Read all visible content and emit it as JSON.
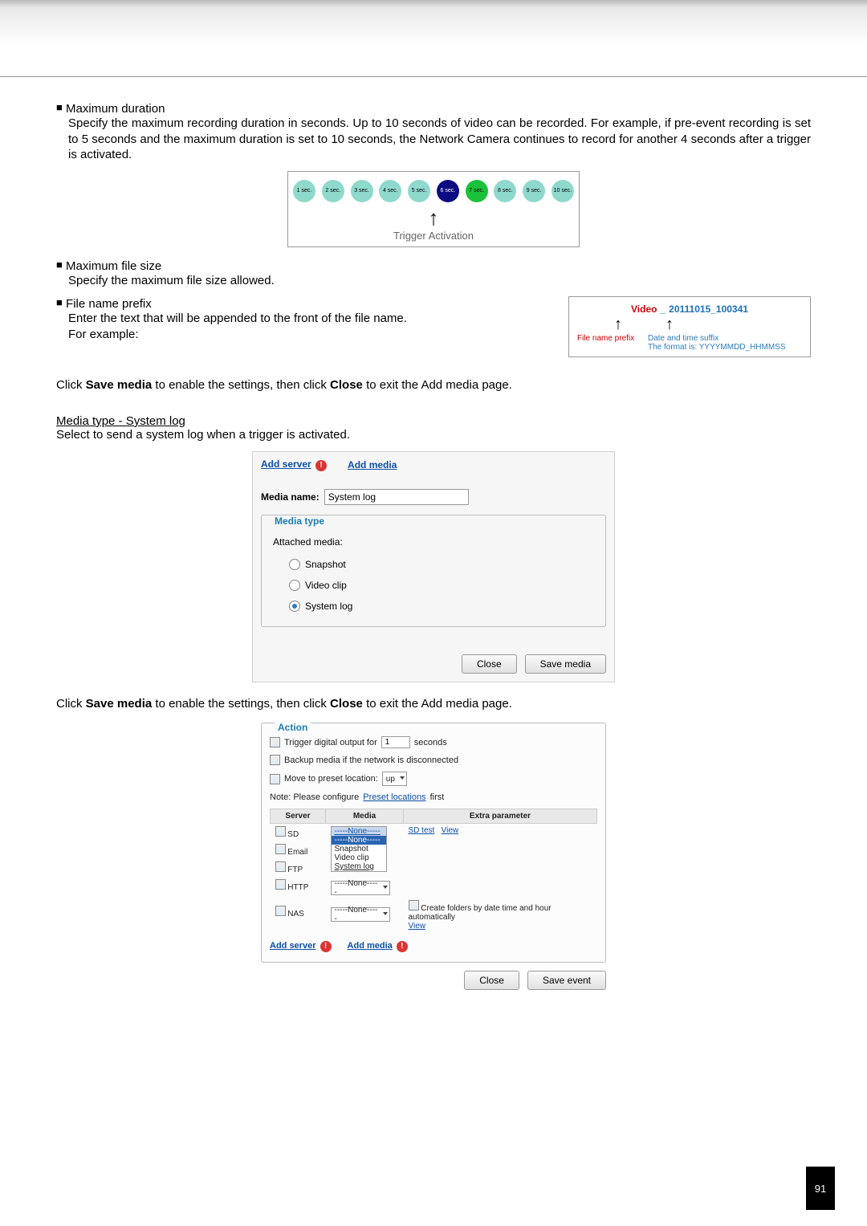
{
  "page_number": "91",
  "sec_max_dur": {
    "title": "Maximum duration",
    "body": "Specify the maximum recording duration in seconds. Up to 10 seconds of video can be recorded. For example, if pre-event recording is set to 5 seconds and the maximum duration is set to 10 seconds, the Network Camera continues to record for another 4 seconds after a trigger is activated."
  },
  "trigger_diagram": {
    "labels": [
      "1 sec.",
      "2 sec.",
      "3 sec.",
      "4 sec.",
      "5 sec.",
      "6 sec.",
      "7 sec.",
      "8 sec.",
      "9 sec.",
      "10 sec."
    ],
    "caption": "Trigger Activation"
  },
  "sec_max_size": {
    "title": "Maximum file size",
    "body": "Specify the maximum file size allowed."
  },
  "sec_prefix": {
    "title": "File name prefix",
    "body1": "Enter the text that will be appended to the front of the file name.",
    "body2": "For example:"
  },
  "fn_example": {
    "prefix": "Video",
    "sep": "_",
    "suffix": "20111015_100341",
    "label_prefix": "File name prefix",
    "label_suffix_l1": "Date and time suffix",
    "label_suffix_l2": "The format is: YYYYMMDD_HHMMSS"
  },
  "save_line": {
    "pre": "Click ",
    "b1": "Save media",
    "mid": " to enable the settings, then click ",
    "b2": "Close",
    "post": " to exit the Add media page."
  },
  "syslog": {
    "title": "Media type - System log",
    "body": "Select to send a system log when a trigger is activated."
  },
  "media_panel": {
    "link_addserver": "Add server",
    "link_addmedia": "Add media",
    "media_name_label": "Media name:",
    "media_name_value": "System log",
    "fieldset_title": "Media type",
    "attached_label": "Attached media:",
    "opt_snapshot": "Snapshot",
    "opt_videoclip": "Video clip",
    "opt_systemlog": "System log",
    "btn_close": "Close",
    "btn_save": "Save media"
  },
  "action_panel": {
    "fieldset_title": "Action",
    "row_trigger_prefix": "Trigger digital output for",
    "row_trigger_val": "1",
    "row_trigger_suffix": "seconds",
    "row_backup": "Backup media if the network is disconnected",
    "row_move_prefix": "Move to preset location:",
    "row_move_val": "up",
    "note": "Note: Please configure ",
    "note_link": "Preset locations",
    "note_post": " first",
    "th_server": "Server",
    "th_media": "Media",
    "th_extra": "Extra parameter",
    "rows": [
      {
        "server": "SD",
        "media_sel": "-----None-----",
        "extra_links": [
          "SD test",
          "View"
        ],
        "expanded": [
          "-----None-----",
          "Snapshot",
          "Video clip",
          "System log"
        ]
      },
      {
        "server": "Email",
        "media_sel": ""
      },
      {
        "server": "FTP",
        "media_sel": ""
      },
      {
        "server": "HTTP",
        "media_sel": "-----None-----"
      },
      {
        "server": "NAS",
        "media_sel": "-----None-----",
        "extra_text": "Create folders by date time and hour automatically",
        "extra_link": "View"
      }
    ],
    "link_addserver": "Add server",
    "link_addmedia": "Add media",
    "btn_close": "Close",
    "btn_save": "Save event"
  }
}
